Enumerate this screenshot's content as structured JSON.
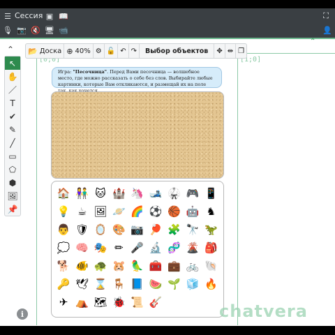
{
  "header": {
    "session_label": "Сессия",
    "top_icons": [
      "menu-icon",
      "screen-icon",
      "book-icon",
      "fullscreen-icon",
      "chat-icon"
    ],
    "media_icons": [
      "mic-off-icon",
      "camera-off-icon",
      "speaker-off-icon",
      "screen-share-icon",
      "video-off-icon"
    ],
    "user_icon": "user-icon"
  },
  "board": {
    "coord_origin": "[0;0]",
    "coord_right": "[1;0]"
  },
  "toolbar": {
    "board_label": "Доска",
    "zoom_label": "40%",
    "title": "Выбор объектов"
  },
  "left_tools": [
    "select",
    "hand",
    "pen",
    "text",
    "check",
    "marker",
    "line",
    "rectangle",
    "polygon",
    "cube",
    "image",
    "pin"
  ],
  "game": {
    "instruction_bold": "\"Песочница\"",
    "instruction_prefix": "Игра: ",
    "instruction_rest": ". Перед Вами песочница — волшебное место, где можно рассказать о себе без слов. Выбирайте любые картинки, которые Вам откликаются, и размещай их на поле так, как хочется."
  },
  "icons": [
    "🏠",
    "👫",
    "🐱",
    "🏰",
    "🦄",
    "🎿",
    "🥋",
    "🎮",
    "📱",
    "💡",
    "☕",
    "🖼",
    "🪐",
    "🌈",
    "⚽",
    "🏀",
    "🤖",
    "♞",
    "👨",
    "🛡",
    "🪞",
    "🎨",
    "📷",
    "🏓",
    "🧩",
    "🔭",
    "🦖",
    "💭",
    "🧠",
    "🎭",
    "✏",
    "🎤",
    "🔬",
    "🧬",
    "🌋",
    "🎒",
    "🐕",
    "🐠",
    "🐢",
    "🐹",
    "🦜",
    "🧰",
    "💼",
    "🚲",
    "🐚",
    "🔑",
    "🕊",
    "⌛",
    "🪑",
    "📘",
    "🍉",
    "🌱",
    "🧊",
    "🔥",
    "✈",
    "⛺",
    "🗺",
    "🐞",
    "📜",
    "🎸"
  ],
  "watermark": "chatvera",
  "info_label": "i"
}
